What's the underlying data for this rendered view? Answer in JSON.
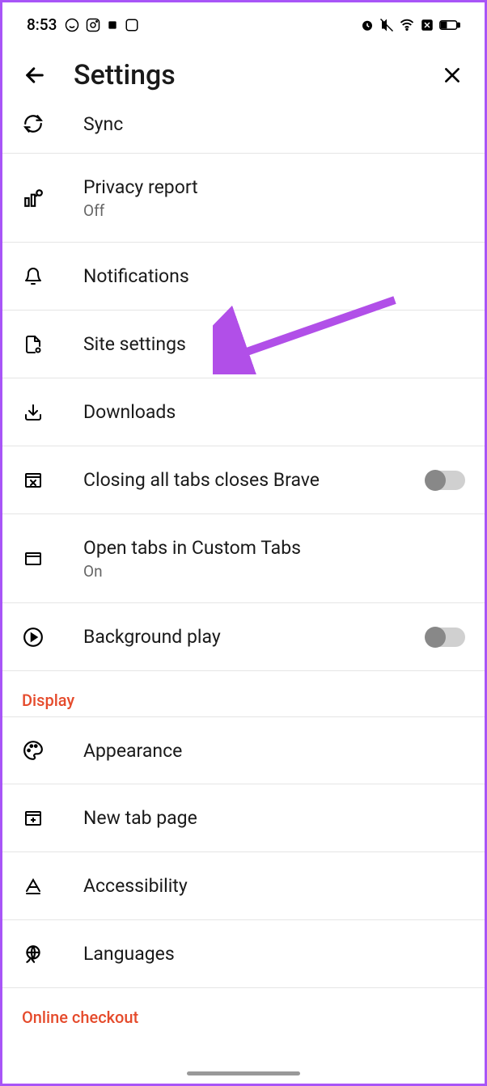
{
  "statusBar": {
    "time": "8:53"
  },
  "header": {
    "title": "Settings"
  },
  "items": {
    "sync": {
      "label": "Sync"
    },
    "privacyReport": {
      "label": "Privacy report",
      "sublabel": "Off"
    },
    "notifications": {
      "label": "Notifications"
    },
    "siteSettings": {
      "label": "Site settings"
    },
    "downloads": {
      "label": "Downloads"
    },
    "closingTabs": {
      "label": "Closing all tabs closes Brave"
    },
    "customTabs": {
      "label": "Open tabs in Custom Tabs",
      "sublabel": "On"
    },
    "backgroundPlay": {
      "label": "Background play"
    },
    "appearance": {
      "label": "Appearance"
    },
    "newTabPage": {
      "label": "New tab page"
    },
    "accessibility": {
      "label": "Accessibility"
    },
    "languages": {
      "label": "Languages"
    }
  },
  "sections": {
    "display": "Display",
    "onlineCheckout": "Online checkout"
  }
}
